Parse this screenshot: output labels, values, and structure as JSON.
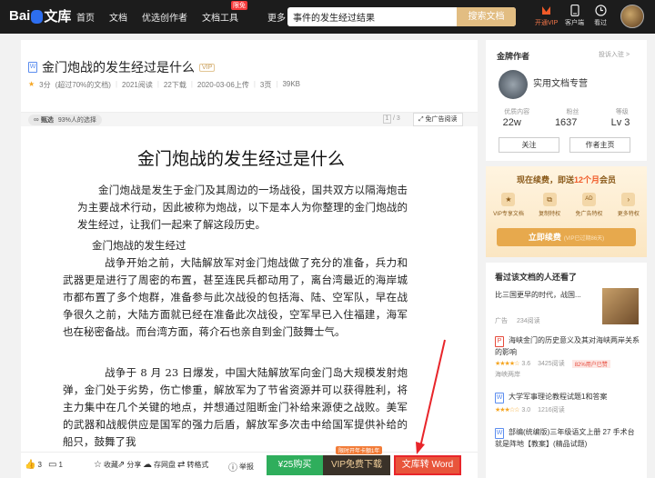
{
  "topbar": {
    "logo_text": "Bai",
    "logo_text2": "文库",
    "nav": [
      {
        "label": "首页"
      },
      {
        "label": "文档"
      },
      {
        "label": "优选创作者"
      },
      {
        "label": "文档工具",
        "badge": "限免"
      },
      {
        "label": "更多"
      }
    ],
    "search_value": "事件的发生经过结果",
    "search_button": "搜索文档",
    "icons": [
      {
        "label": "开通VIP",
        "icon": "vip-crown-icon"
      },
      {
        "label": "客户端",
        "icon": "phone-icon"
      },
      {
        "label": "看过",
        "icon": "clock-icon"
      }
    ]
  },
  "doc": {
    "title": "金门炮战的发生经过是什么",
    "vip": "VIP",
    "type_icon": "W",
    "rating": "3分",
    "rating_note": "(超过70%的文档)",
    "reads": "2021阅读",
    "downloads": "22下载",
    "upload": "2020-03-06上传",
    "pages": "3页",
    "size": "39KB",
    "select_tag": "甄选",
    "select_tag_note": "93%人的选择",
    "page_indicator": "1",
    "page_total": "/ 3",
    "adfree": "免广告阅读"
  },
  "content": {
    "title": "金门炮战的发生经过是什么",
    "paragraphs": [
      "金门炮战是发生于金门及其周边的一场战役，国共双方以隔海炮击为主要战术行动，因此被称为炮战，以下是本人为你整理的金门炮战的发生经过，让我们一起来了解这段历史。",
      "金门炮战的发生经过",
      "战争开始之前，大陆解放军对金门炮战做了充分的准备，兵力和武器更是进行了周密的布置，甚至连民兵都动用了，离台湾最近的海岸城市都布置了多个炮群，准备参与此次战役的包括海、陆、空军队，早在战争很久之前，大陆方面就已经在准备此次战役，空军早已入住福建，海军也在秘密备战。而台湾方面，蒋介石也亲自到金门鼓舞士气。",
      "战争于 8 月 23 日爆发，中国大陆解放军向金门岛大规模发射炮弹，金门处于劣势，伤亡惨重，解放军为了节省资源并可以获得胜利，将主力集中在几个关键的地点，并想通过阻断金门补给来源使之战败。美军的武器和战舰供应是国军的强力后盾，解放军多次击中给国军提供补给的船只，鼓舞了我"
    ]
  },
  "bottombar": {
    "like": "3",
    "comment": "1",
    "fav": "收藏",
    "share": "分享",
    "netdisk": "存网盘",
    "convert": "转格式",
    "report": "举报",
    "buy": "¥25购买",
    "vip_download": "VIP免费下载",
    "promo": "限时开年卡额1年",
    "to_word": "文库转 Word"
  },
  "author": {
    "heading": "金牌作者",
    "report": "投诉入驻 >",
    "name": "实用文档专营",
    "stats_labels": [
      "优质内容",
      "粉丝",
      "等级"
    ],
    "stats_values": [
      "22w",
      "1637",
      "Lv 3"
    ],
    "follow": "关注",
    "home": "作者主页"
  },
  "vipbox": {
    "heading": "现在续费，即送",
    "highlight": "12个月",
    "heading_end": "会员",
    "perks": [
      "VIP专享文档",
      "复制特权",
      "免广告特权",
      "更多特权"
    ],
    "button": "立即续费",
    "button_note": "(VIP已过期86天)"
  },
  "recommend": {
    "heading": "看过该文档的人还看了",
    "items": [
      {
        "title": "比三国更早的时代，战国...",
        "tag": "广告",
        "reads": "234阅读"
      },
      {
        "title": "海峡金门的历史意义及其对海峡两岸关系的影响",
        "score": "3.6",
        "reads": "3425阅读",
        "pct": "82%用户已赞",
        "extra": "海峡两岸"
      },
      {
        "title": "大学军事理论教程试题1和答案",
        "score": "3.0",
        "reads": "1216阅读"
      },
      {
        "title": "部编(统编版)三年级语文上册 27 手术台就是阵地【教案】(精品试题)"
      }
    ]
  },
  "colors": {
    "topbar": "#1c1c1c",
    "accent": "#e2bd82",
    "buy_green": "#2fae5c",
    "vip_dark": "#3a3229",
    "word_red": "#e8553b",
    "arrow_red": "#e8252a"
  }
}
